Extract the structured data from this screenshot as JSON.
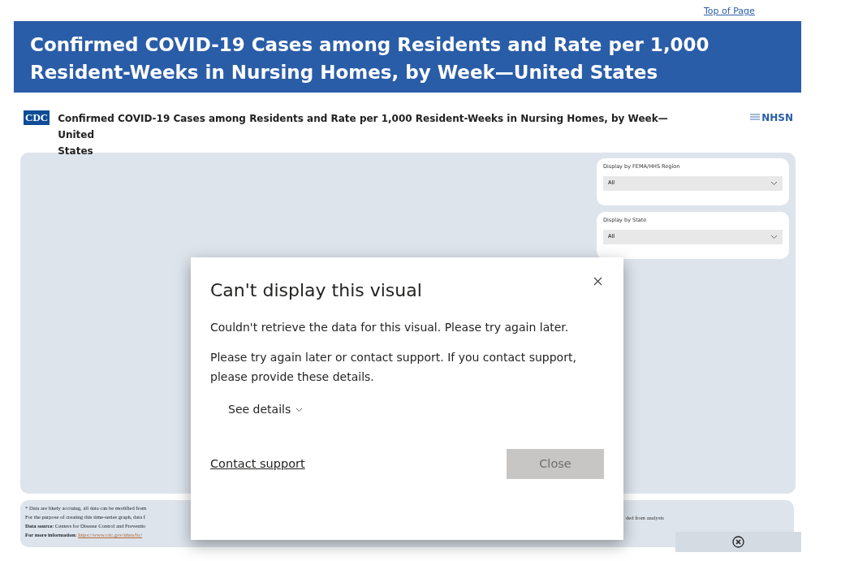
{
  "top_link": "Top of Page",
  "banner": {
    "title": "Confirmed COVID-19 Cases among Residents and Rate per 1,000 Resident-Weeks in Nursing Homes, by Week—United States"
  },
  "report": {
    "logo": "CDC",
    "title_lines": [
      "Confirmed COVID-19 Cases among Residents and Rate per 1,000 Resident-Weeks in Nursing Homes, by Week—",
      "United",
      "States"
    ],
    "partner_logo": "NHSN"
  },
  "filters": [
    {
      "label": "Display by FEMA/HHS Region",
      "value": "All"
    },
    {
      "label": "Display by State",
      "value": "All"
    }
  ],
  "footnotes": [
    {
      "kind": "plain",
      "text": "* Data are likely accruing, all data can be modified from"
    },
    {
      "kind": "plain",
      "text": "For the purpose of creating this time-series graph, data f"
    },
    {
      "kind": "labeled",
      "label": "Data source",
      "text": ": Centers for Disease Control and Preventio"
    },
    {
      "kind": "link",
      "label": "For more information",
      "separator": ": ",
      "text": "https://www.cdc.gov/nhsn/ltc/"
    }
  ],
  "footnote_right": "ded from analysis",
  "dialog": {
    "title": "Can't display this visual",
    "message": "Couldn't retrieve the data for this visual. Please try again later.",
    "detail": "Please try again later or contact support. If you contact support, please provide these details.",
    "details_toggle": "See details",
    "expanded": false,
    "link": "Contact support",
    "button": "Close"
  }
}
